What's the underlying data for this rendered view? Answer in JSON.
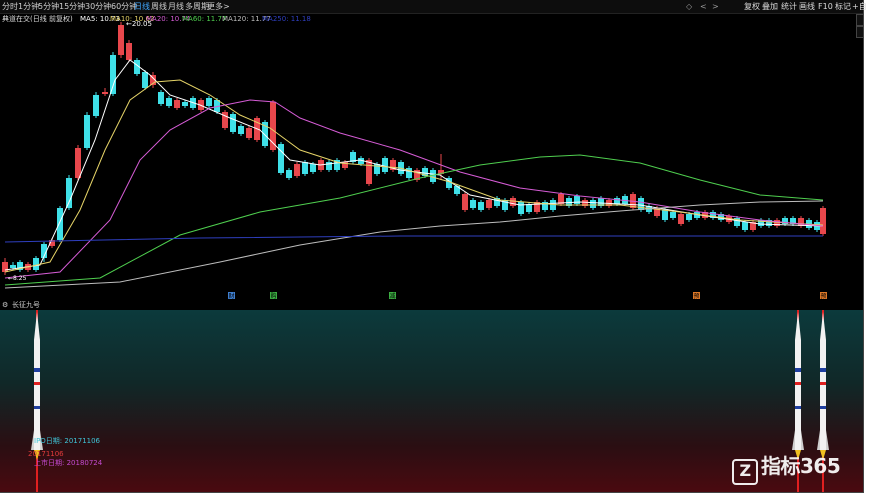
{
  "toolbar": {
    "periods": [
      "分时",
      "1分钟",
      "5分钟",
      "15分钟",
      "30分钟",
      "60分钟",
      "日线",
      "周线",
      "月线",
      "多周期",
      "更多",
      ">"
    ],
    "active_period": "日线",
    "right_buttons": [
      "复权",
      "叠加",
      "统计",
      "画线",
      "F10",
      "标记",
      "+自"
    ],
    "window_icons": [
      "◇",
      "<",
      ">"
    ]
  },
  "main_chart": {
    "title": "典道在交(日线 前复权)",
    "ma_items": [
      {
        "label": "MA5: 10.73",
        "color": "#ffffff"
      },
      {
        "label": "MA10: 10.62",
        "color": "#e6d468"
      },
      {
        "label": "MA20: 10.74",
        "color": "#d65cd6"
      },
      {
        "label": "MA60: 11.77",
        "color": "#4fcf4f"
      },
      {
        "label": "MA120: 11.77",
        "color": "#bdbdbd"
      },
      {
        "label": "MA250: 11.18",
        "color": "#2f3fbf"
      }
    ],
    "high_label": "20.05",
    "low_label": "8.25",
    "event_markers": [
      {
        "text": "财",
        "color": "#3f7fd0"
      },
      {
        "text": "购",
        "color": "#3cb043"
      },
      {
        "text": "减",
        "color": "#3cb043"
      },
      {
        "text": "预",
        "color": "#e07a28"
      },
      {
        "text": "预",
        "color": "#e07a28"
      }
    ]
  },
  "indicator_panel": {
    "title": "长征九号",
    "labels": [
      {
        "text": "IPO日期: 20171106",
        "color": "#3fc3d6"
      },
      {
        "text": "20171106",
        "color": "#e03a3a"
      },
      {
        "text": "上市日期: 20180724",
        "color": "#c44ad0"
      }
    ]
  },
  "watermark": {
    "logo": "Z",
    "text": "指标365"
  },
  "colors": {
    "up": "#e8474c",
    "down": "#3fe0e8"
  }
}
